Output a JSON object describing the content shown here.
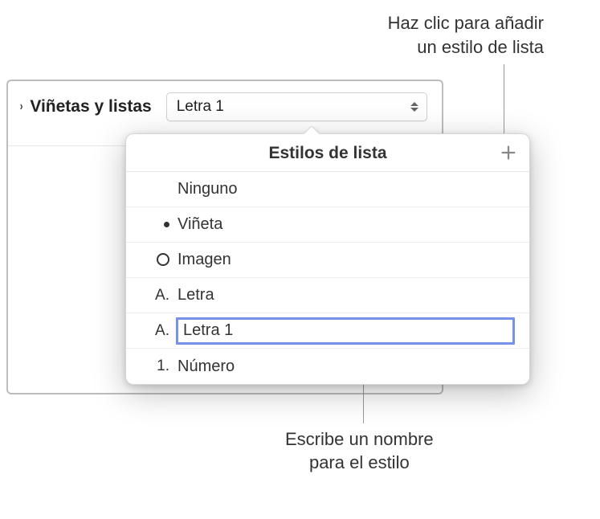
{
  "annotations": {
    "top": {
      "line1": "Haz clic para añadir",
      "line2": "un estilo de lista"
    },
    "bottom": {
      "line1": "Escribe un nombre",
      "line2": "para el estilo"
    }
  },
  "section": {
    "title": "Viñetas y listas",
    "selectedValue": "Letra 1"
  },
  "popover": {
    "title": "Estilos de lista",
    "items": [
      {
        "marker": "",
        "label": "Ninguno",
        "type": "none"
      },
      {
        "marker": "dot",
        "label": "Viñeta",
        "type": "bullet"
      },
      {
        "marker": "circle",
        "label": "Imagen",
        "type": "image"
      },
      {
        "marker": "A.",
        "label": "Letra",
        "type": "letter"
      },
      {
        "marker": "A.",
        "label": "Letra 1",
        "type": "letter",
        "editing": true
      },
      {
        "marker": "1.",
        "label": "Número",
        "type": "number"
      }
    ]
  }
}
